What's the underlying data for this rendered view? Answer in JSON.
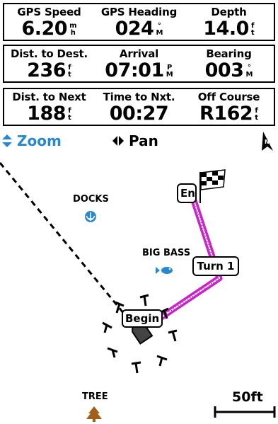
{
  "fields": [
    [
      {
        "label": "GPS Speed",
        "value": "6.20",
        "unit": [
          "m",
          "h"
        ]
      },
      {
        "label": "GPS Heading",
        "value": "024",
        "unit": [
          "°",
          "M"
        ]
      },
      {
        "label": "Depth",
        "value": "14.0",
        "unit": [
          "f",
          "t"
        ]
      }
    ],
    [
      {
        "label": "Dist. to Dest.",
        "value": "236",
        "unit": [
          "f",
          "t"
        ]
      },
      {
        "label": "Arrival",
        "value": "07:01",
        "unit": [
          "P",
          "M"
        ]
      },
      {
        "label": "Bearing",
        "value": "003",
        "unit": [
          "°",
          "M"
        ]
      }
    ],
    [
      {
        "label": "Dist. to Next",
        "value": "188",
        "unit": [
          "f",
          "t"
        ]
      },
      {
        "label": "Time to Nxt.",
        "value": "00:27",
        "unit": [
          "",
          ""
        ]
      },
      {
        "label": "Off Course",
        "value": "R162",
        "unit": [
          "f",
          "t"
        ]
      }
    ]
  ],
  "toolbar": {
    "zoom_label": "Zoom",
    "pan_label": "Pan",
    "north_letter": "N"
  },
  "map": {
    "docks_label": "DOCKS",
    "bigbass_label": "BIG BASS",
    "tree_label": "TREE",
    "turn_label": "Turn 1",
    "begin_label": "Begin",
    "end_label": "End",
    "scale_label": "50ft",
    "route_color": "#cc22cc"
  }
}
